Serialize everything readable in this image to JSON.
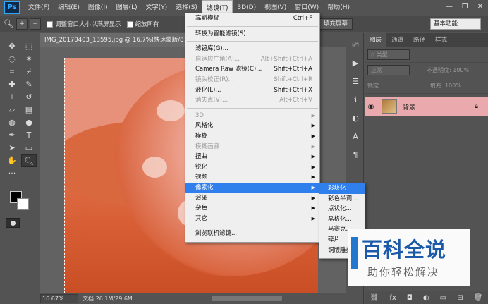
{
  "app": {
    "logo": "Ps"
  },
  "menubar": {
    "items": [
      "文件(F)",
      "编辑(E)",
      "图像(I)",
      "图层(L)",
      "文字(Y)",
      "选择(S)",
      "滤镜(T)",
      "3D(D)",
      "视图(V)",
      "窗口(W)",
      "帮助(H)"
    ],
    "active_index": 6
  },
  "window_controls": {
    "minimize": "—",
    "restore": "❐",
    "close": "✕"
  },
  "options_bar": {
    "zoom_icon": "zoom-icon",
    "resize_label": "调整窗口大小以满屏显示",
    "zoom_all_label": "缩放所有",
    "fill_screen_label": "填充屏幕",
    "workspace": "基本功能"
  },
  "document": {
    "tab_title": "IMG_20170403_13595.jpg @ 16.7%(快速蒙版/8) *",
    "zoom": "16.67%",
    "doc_info": "文档:26.1M/29.6M"
  },
  "layers_panel": {
    "tabs": [
      "图层",
      "通道",
      "路径",
      "样式"
    ],
    "kind_filter": "ρ 类型",
    "blend_mode": "正常",
    "opacity_label": "不透明度: 100%",
    "lock_label": "锁定:",
    "fill_label": "填充: 100%",
    "layer_name": "背景"
  },
  "filter_menu": {
    "top_items": [
      {
        "label": "高斯模糊",
        "shortcut": "Ctrl+F",
        "disabled": false
      }
    ],
    "group2": [
      {
        "label": "转换为智能滤镜(S)",
        "shortcut": "",
        "disabled": false
      }
    ],
    "group3": [
      {
        "label": "滤镜库(G)...",
        "shortcut": "",
        "disabled": false
      },
      {
        "label": "自适应广角(A)...",
        "shortcut": "Alt+Shift+Ctrl+A",
        "disabled": true
      },
      {
        "label": "Camera Raw 滤镜(C)...",
        "shortcut": "Shift+Ctrl+A",
        "disabled": false
      },
      {
        "label": "镜头校正(R)...",
        "shortcut": "Shift+Ctrl+R",
        "disabled": true
      },
      {
        "label": "液化(L)...",
        "shortcut": "Shift+Ctrl+X",
        "disabled": false
      },
      {
        "label": "消失点(V)...",
        "shortcut": "Alt+Ctrl+V",
        "disabled": true
      }
    ],
    "group4": [
      {
        "label": "3D",
        "disabled": true
      },
      {
        "label": "风格化",
        "disabled": false
      },
      {
        "label": "模糊",
        "disabled": false
      },
      {
        "label": "模糊画廊",
        "disabled": true
      },
      {
        "label": "扭曲",
        "disabled": false
      },
      {
        "label": "锐化",
        "disabled": false
      },
      {
        "label": "视频",
        "disabled": false
      },
      {
        "label": "像素化",
        "disabled": false,
        "highlight": true
      },
      {
        "label": "渲染",
        "disabled": false
      },
      {
        "label": "杂色",
        "disabled": false
      },
      {
        "label": "其它",
        "disabled": false
      }
    ],
    "group5": [
      {
        "label": "浏览联机滤镜...",
        "disabled": false
      }
    ]
  },
  "pixelate_submenu": {
    "items": [
      "彩块化",
      "彩色半调...",
      "点状化...",
      "晶格化...",
      "马赛克...",
      "碎片",
      "铜版雕刻..."
    ],
    "highlight_index": 0
  },
  "watermark": {
    "title": "百科全说",
    "subtitle": "助你轻松解决"
  }
}
